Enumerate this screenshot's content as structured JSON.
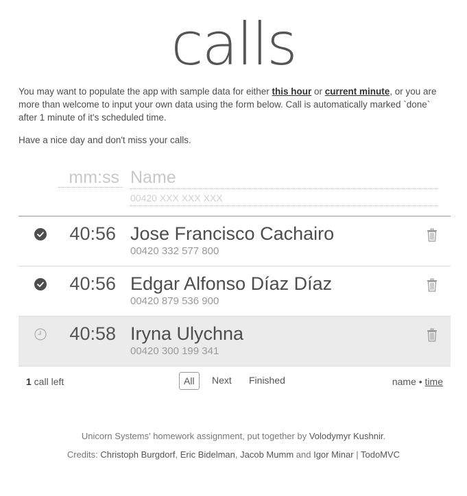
{
  "app": {
    "title": "calls"
  },
  "intro": {
    "part1": "You may want to populate the app with sample data for either ",
    "link_hour": "this hour",
    "part2": " or ",
    "link_minute": "current minute",
    "part3": ", or you are more than welcome to input your own data using the form below. Call is automatically marked `done` after 1 minute of it's scheduled time.",
    "part4": "Have a nice day and don't miss your calls."
  },
  "form": {
    "time_placeholder": "mm:ss",
    "name_placeholder": "Name",
    "phone_placeholder": "00420 XXX XXX XXX"
  },
  "calls": [
    {
      "time": "40:56",
      "name": "Jose Francisco Cachairo",
      "phone": "00420 332 577 800",
      "status": "done",
      "status_icon": "check-circle-icon"
    },
    {
      "time": "40:56",
      "name": "Edgar Alfonso Díaz Díaz",
      "phone": "00420 879 536 900",
      "status": "done",
      "status_icon": "check-circle-icon"
    },
    {
      "time": "40:58",
      "name": "Iryna Ulychna",
      "phone": "00420 300 199 341",
      "status": "pending",
      "status_icon": "clock-icon"
    }
  ],
  "footer": {
    "count": "1",
    "count_suffix": " call left",
    "filters": [
      "All",
      "Next",
      "Finished"
    ],
    "active_filter": "All",
    "sort_name": "name",
    "sort_sep": " • ",
    "sort_time": "time",
    "active_sort": "time"
  },
  "credits": {
    "line1_prefix": "Unicorn Systems' homework assignment, put together by ",
    "author": "Volodymyr Kushnir",
    "line1_suffix": ".",
    "line2_prefix": "Credits: ",
    "c1": "Christoph Burgdorf",
    "sep1": ", ",
    "c2": "Eric Bidelman",
    "sep2": ", ",
    "c3": "Jacob Mumm",
    "and": " and ",
    "c4": "Igor Minar",
    "pipe": " | ",
    "c5": "TodoMVC"
  },
  "colors": {
    "accent": "#333333",
    "pending_row_bg": "#ebebeb",
    "divider": "#999999"
  }
}
